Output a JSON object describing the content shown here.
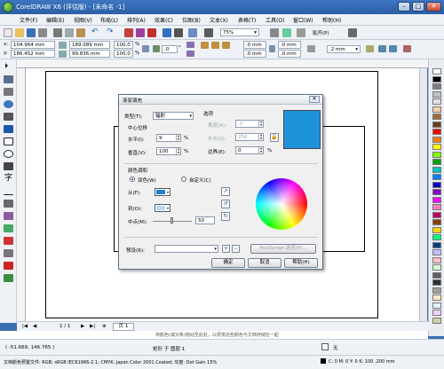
{
  "window": {
    "title": "CorelDRAW X6 (评估版) - [未命名 -1]"
  },
  "menu": [
    "文件(F)",
    "编辑(E)",
    "视图(V)",
    "布局(L)",
    "排列(A)",
    "效果(C)",
    "位图(B)",
    "文本(X)",
    "表格(T)",
    "工具(O)",
    "窗口(W)",
    "帮助(H)"
  ],
  "toolbar": {
    "zoom": "75%",
    "snap": "贴齐(P)"
  },
  "props": {
    "x": "104.964 mm",
    "y": "186.452 mm",
    "w": "189.089 mm",
    "h": "99.836 mm",
    "sx": "100.0",
    "sy": "100.0",
    "pct": "%",
    "angle": ".0",
    "deg": "°",
    "c1": ".0 mm",
    "c2": ".0 mm",
    "c3": ".0 mm",
    "c4": ".0 mm",
    "outline": ".2 mm"
  },
  "dialog": {
    "title": "渐变填充",
    "type_label": "类型(T):",
    "type_value": "辐射",
    "options_label": "选项",
    "center_label": "中心位移",
    "horiz_label": "水平(I):",
    "horiz_value": "9",
    "vert_label": "垂直(V):",
    "vert_value": "100",
    "angle_label": "角度(A):",
    "angle_value": ".0",
    "steps_label": "步长(S):",
    "steps_value": "256",
    "edge_label": "边界(E):",
    "edge_value": "0",
    "pct": "%",
    "blend_label": "颜色调和",
    "two_color": "双色(W)",
    "custom": "自定义(C)",
    "from_label": "从(F):",
    "from_color": "#1b7fd0",
    "to_label": "到(O):",
    "to_color": "#b9dcf5",
    "mid_label": "中点(M):",
    "mid_value": "50",
    "preset_label": "预设(R):",
    "postscript": "PostScript 选项(P)...",
    "ok": "确定",
    "cancel": "取消",
    "help": "帮助(H)",
    "preview_color": "#1e93da"
  },
  "pagebar": {
    "pager": "1 / 1",
    "page_tab": "页 1"
  },
  "hint": "将颜色(或对象)拖动至此处，以便将这些颜色与文档存储在一起",
  "status": {
    "coords": "( -51.669, 146.765 )",
    "object": "矩形 于 图层 1",
    "profile": "文档颜色预置文件: RGB: sRGB IEC61966-2.1; CMYK: Japan Color 2001 Coated; 灰度: Dot Gain 15%",
    "fill": "无",
    "outline": "C: 0 M: 0 Y: 0 K: 100 .200 mm"
  },
  "palette_colors": [
    "#ffffff",
    "#000000",
    "#7f7f7f",
    "#c0c0c0",
    "#e0e0e0",
    "#f2d0a9",
    "#9c6b3a",
    "#6b3d1f",
    "#ff0000",
    "#ff8000",
    "#ffff00",
    "#80ff00",
    "#00a000",
    "#00c0c0",
    "#0080ff",
    "#0000c0",
    "#8000c0",
    "#ff00ff",
    "#ff80c0",
    "#c00060",
    "#804000",
    "#ffd700",
    "#00ff80",
    "#004080",
    "#c0c0ff",
    "#ffc0c0",
    "#d0ffd0",
    "#606060",
    "#303030",
    "#a0a0a0",
    "#ffe8c0",
    "#e0f0ff",
    "#f0d0ff",
    "#d0d0a0"
  ]
}
